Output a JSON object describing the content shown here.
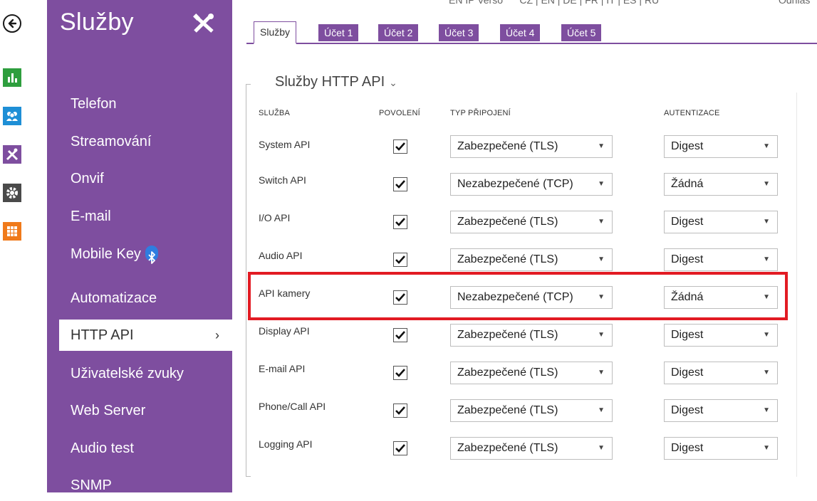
{
  "header": {
    "languages": "CZ | EN | DE | FR | IT | ES | RU",
    "version_partial": "EN IP Verso",
    "logout_partial": "Odhlás"
  },
  "sidebar": {
    "title": "Služby",
    "items": [
      {
        "label": "Telefon"
      },
      {
        "label": "Streamování"
      },
      {
        "label": "Onvif"
      },
      {
        "label": "E-mail"
      },
      {
        "label": "Mobile Key"
      },
      {
        "label": "Automatizace"
      },
      {
        "label": "HTTP API",
        "chevron": "›"
      },
      {
        "label": "Uživatelské zvuky"
      },
      {
        "label": "Web Server"
      },
      {
        "label": "Audio test"
      },
      {
        "label": "SNMP"
      }
    ]
  },
  "tabs": [
    {
      "label": "Služby"
    },
    {
      "label": "Účet 1"
    },
    {
      "label": "Účet 2"
    },
    {
      "label": "Účet 3"
    },
    {
      "label": "Účet 4"
    },
    {
      "label": "Účet 5"
    }
  ],
  "section": {
    "title": "Služby HTTP API",
    "caret": "⌄"
  },
  "table": {
    "headers": {
      "service": "SLUŽBA",
      "enabled": "POVOLENÍ",
      "connection": "TYP PŘIPOJENÍ",
      "auth": "AUTENTIZACE"
    },
    "rows": [
      {
        "service": "System API",
        "enabled": true,
        "connection": "Zabezpečené (TLS)",
        "auth": "Digest"
      },
      {
        "service": "Switch API",
        "enabled": true,
        "connection": "Nezabezpečené (TCP)",
        "auth": "Žádná"
      },
      {
        "service": "I/O API",
        "enabled": true,
        "connection": "Zabezpečené (TLS)",
        "auth": "Digest"
      },
      {
        "service": "Audio API",
        "enabled": true,
        "connection": "Zabezpečené (TLS)",
        "auth": "Digest"
      },
      {
        "service": "API kamery",
        "enabled": true,
        "connection": "Nezabezpečené (TCP)",
        "auth": "Žádná"
      },
      {
        "service": "Display API",
        "enabled": true,
        "connection": "Zabezpečené (TLS)",
        "auth": "Digest"
      },
      {
        "service": "E-mail API",
        "enabled": true,
        "connection": "Zabezpečené (TLS)",
        "auth": "Digest"
      },
      {
        "service": "Phone/Call API",
        "enabled": true,
        "connection": "Zabezpečené (TLS)",
        "auth": "Digest"
      },
      {
        "service": "Logging API",
        "enabled": true,
        "connection": "Zabezpečené (TLS)",
        "auth": "Digest"
      }
    ]
  },
  "colors": {
    "brand_purple": "#7e4e9f",
    "highlight_red": "#e21b23",
    "rail_green": "#2e9e3e",
    "rail_blue": "#1e8fd6",
    "rail_dark": "#4a4a4a",
    "rail_orange": "#f07a1a"
  },
  "icons": {
    "back": "arrow-left-circle-icon",
    "status": "bar-chart-icon",
    "users": "users-icon",
    "services": "tools-icon",
    "hardware": "gear-icon",
    "system": "grid-icon",
    "bluetooth": "bluetooth-icon"
  }
}
